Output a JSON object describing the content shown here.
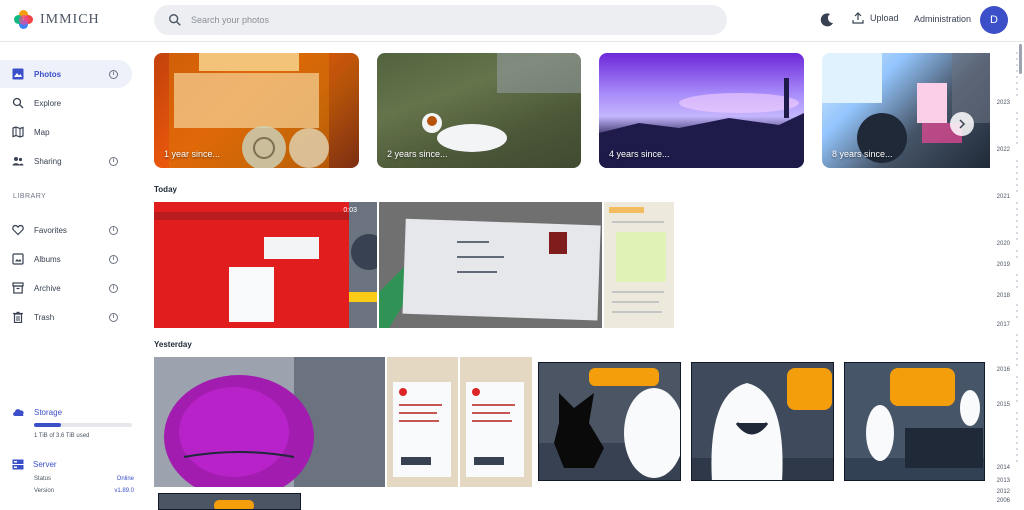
{
  "app": {
    "name": "IMMICH"
  },
  "header": {
    "search_placeholder": "Search your photos",
    "upload_label": "Upload",
    "admin_label": "Administration",
    "avatar_initial": "D"
  },
  "sidebar": {
    "items": [
      {
        "label": "Photos",
        "icon": "photos-icon"
      },
      {
        "label": "Explore",
        "icon": "search-icon"
      },
      {
        "label": "Map",
        "icon": "map-icon"
      },
      {
        "label": "Sharing",
        "icon": "people-icon"
      },
      {
        "label": "Favorites",
        "icon": "heart-icon"
      },
      {
        "label": "Albums",
        "icon": "album-icon"
      },
      {
        "label": "Archive",
        "icon": "archive-icon"
      },
      {
        "label": "Trash",
        "icon": "trash-icon"
      }
    ],
    "library_label": "LIBRARY",
    "storage": {
      "title": "Storage",
      "used_text": "1 TiB of 3.6 TiB used",
      "used_fraction": 0.28
    },
    "server": {
      "title": "Server",
      "status_label": "Status",
      "status_value": "Online",
      "version_label": "Version",
      "version_value": "v1.89.0"
    }
  },
  "memories": [
    {
      "label": "1 year since..."
    },
    {
      "label": "2 years since..."
    },
    {
      "label": "4 years since..."
    },
    {
      "label": "8 years since..."
    }
  ],
  "sections": {
    "today": {
      "title": "Today",
      "video_duration": "0:03"
    },
    "yesterday": {
      "title": "Yesterday"
    }
  },
  "scrubber_years": [
    "2023",
    "2022",
    "2021",
    "2020",
    "2019",
    "2018",
    "2017",
    "2016",
    "2015",
    "2014",
    "2013",
    "2012",
    "2006"
  ],
  "colors": {
    "accent": "#3b4fc9"
  }
}
